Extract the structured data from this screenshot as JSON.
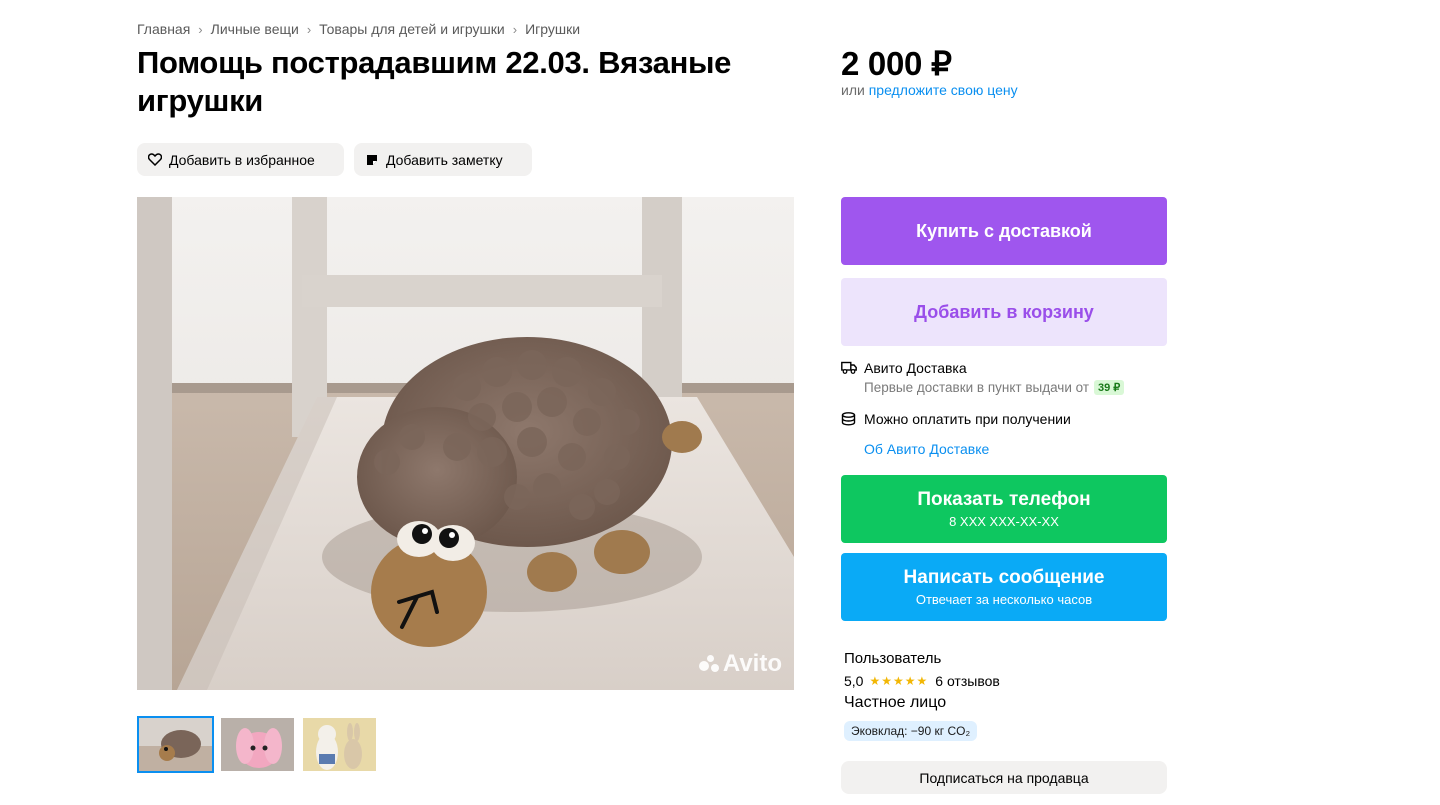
{
  "breadcrumb": [
    "Главная",
    "Личные вещи",
    "Товары для детей и игрушки",
    "Игрушки"
  ],
  "title": "Помощь пострадавшим 22.03. Вязаные игрушки",
  "actions": {
    "favorite_label": "Добавить в избранное",
    "note_label": "Добавить заметку"
  },
  "gallery": {
    "watermark": "Avito",
    "thumbnails": [
      "thumb-sheep",
      "thumb-bunny",
      "thumb-figures"
    ]
  },
  "price": {
    "amount": "2 000 ₽",
    "or_text": "или ",
    "offer_link": "предложите свою цену"
  },
  "buttons": {
    "buy_delivery": "Купить с доставкой",
    "add_to_cart": "Добавить в корзину",
    "phone_title": "Показать телефон",
    "phone_number": "8 XXX XXX-XX-XX",
    "message_title": "Написать сообщение",
    "message_sub": "Отвечает за несколько часов",
    "subscribe": "Подписаться на продавца"
  },
  "delivery": {
    "title": "Авито Доставка",
    "subtitle": "Первые доставки в пункт выдачи от",
    "price_tag": "39 ₽",
    "pay_on_receipt": "Можно оплатить при получении",
    "about_link": "Об Авито Доставке"
  },
  "seller": {
    "name": "Пользователь",
    "rating": "5,0",
    "stars": "★★★★★",
    "reviews": "6 отзывов",
    "type": "Частное лицо",
    "eco": "Эковклад: −90 кг CO₂"
  },
  "colors": {
    "buy": "#9f56ee",
    "cart_bg": "#ede4fc",
    "phone": "#0ec760",
    "message": "#0aaaf6",
    "link": "#0a8ff0"
  }
}
